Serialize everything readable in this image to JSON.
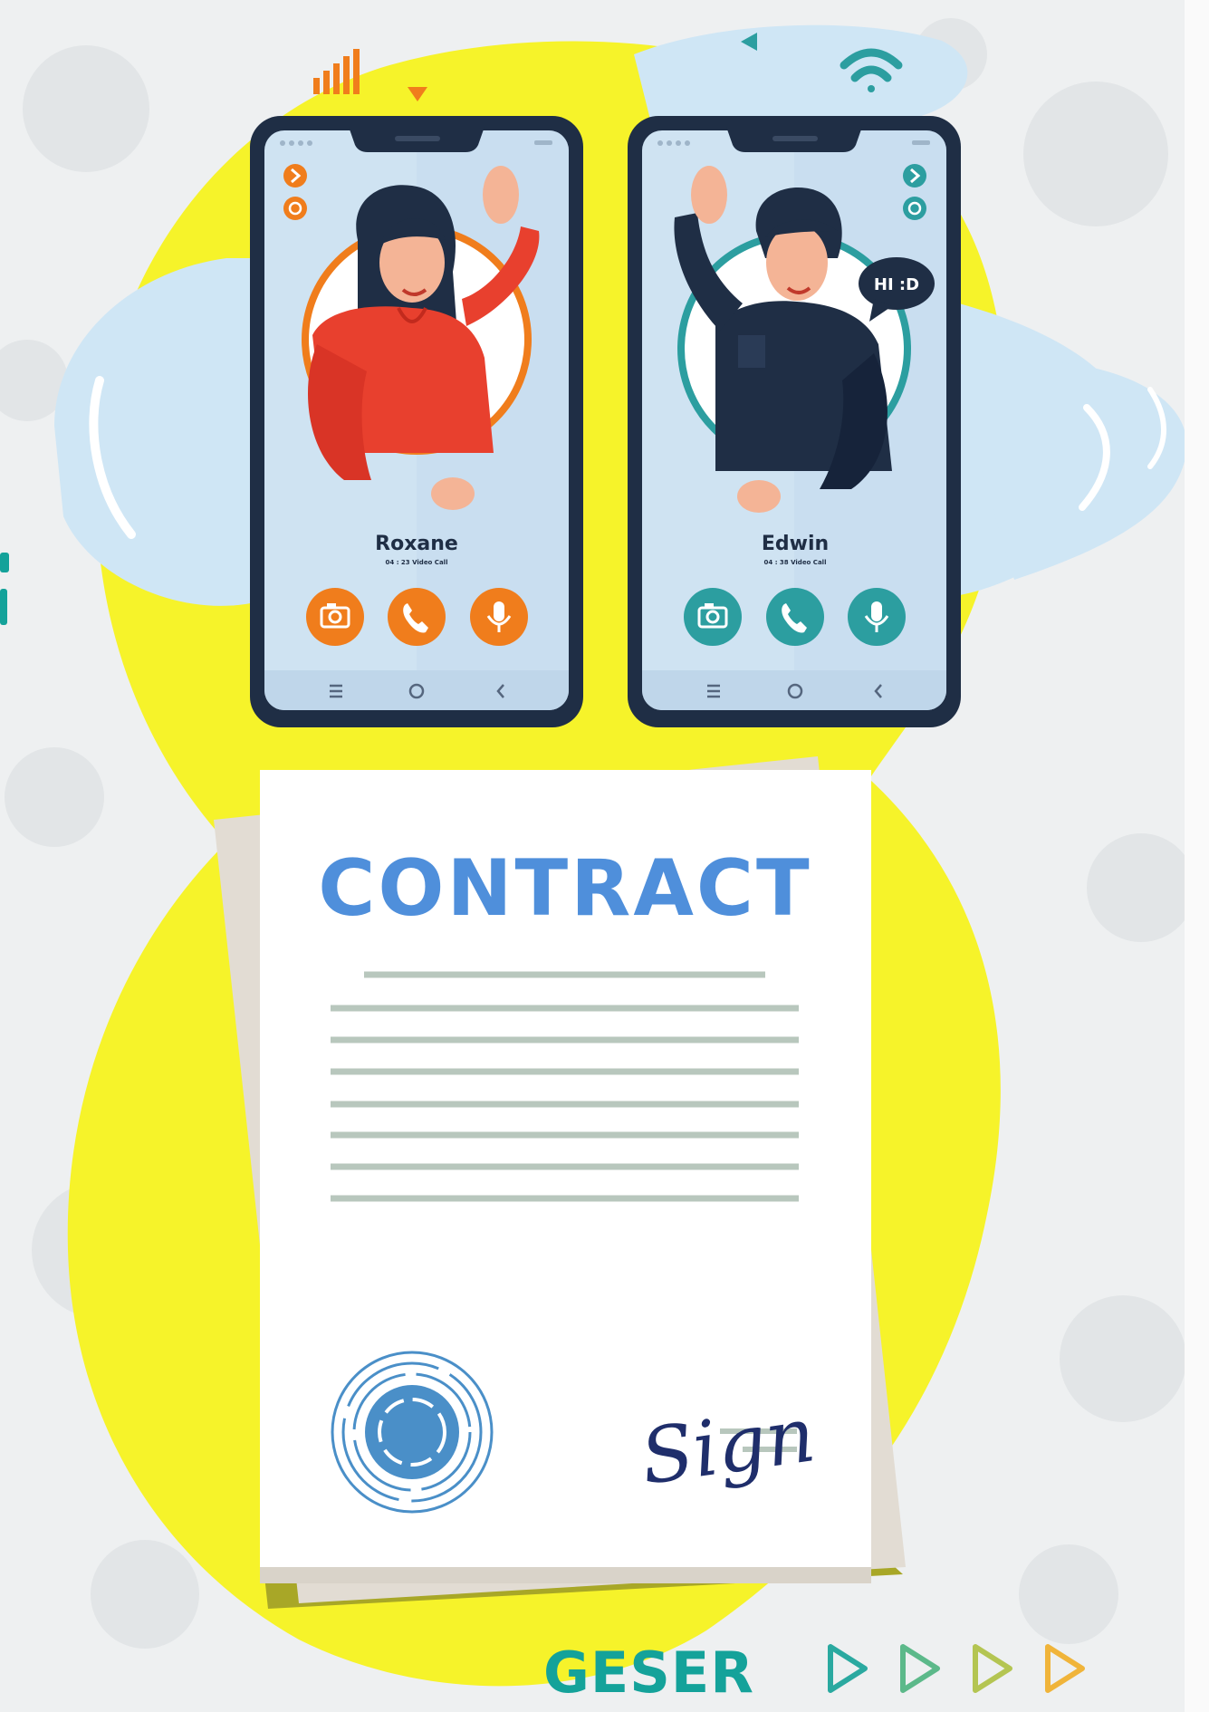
{
  "left_caller": {
    "name": "Roxane",
    "call_info": "04 : 23 Video Call",
    "accent": "#f07d1c"
  },
  "right_caller": {
    "name": "Edwin",
    "call_info": "04 : 38 Video Call",
    "speech_bubble": "HI :D",
    "accent": "#2c9ea0"
  },
  "document": {
    "title": "CONTRACT",
    "signature": "Sign"
  },
  "footer": {
    "label": "GESER",
    "arrow_colors": [
      "#2aa9a0",
      "#5cb98a",
      "#b4c552",
      "#f0b43a"
    ]
  },
  "colors": {
    "background": "#eef0f1",
    "yellow_blob": "#f6f32a",
    "water_blue": "#cfe6f5",
    "phone_frame": "#1f2e45",
    "phone_screen": "#cfe3f2",
    "contract_title": "#4f8fdb",
    "footer_text": "#14a29a"
  }
}
